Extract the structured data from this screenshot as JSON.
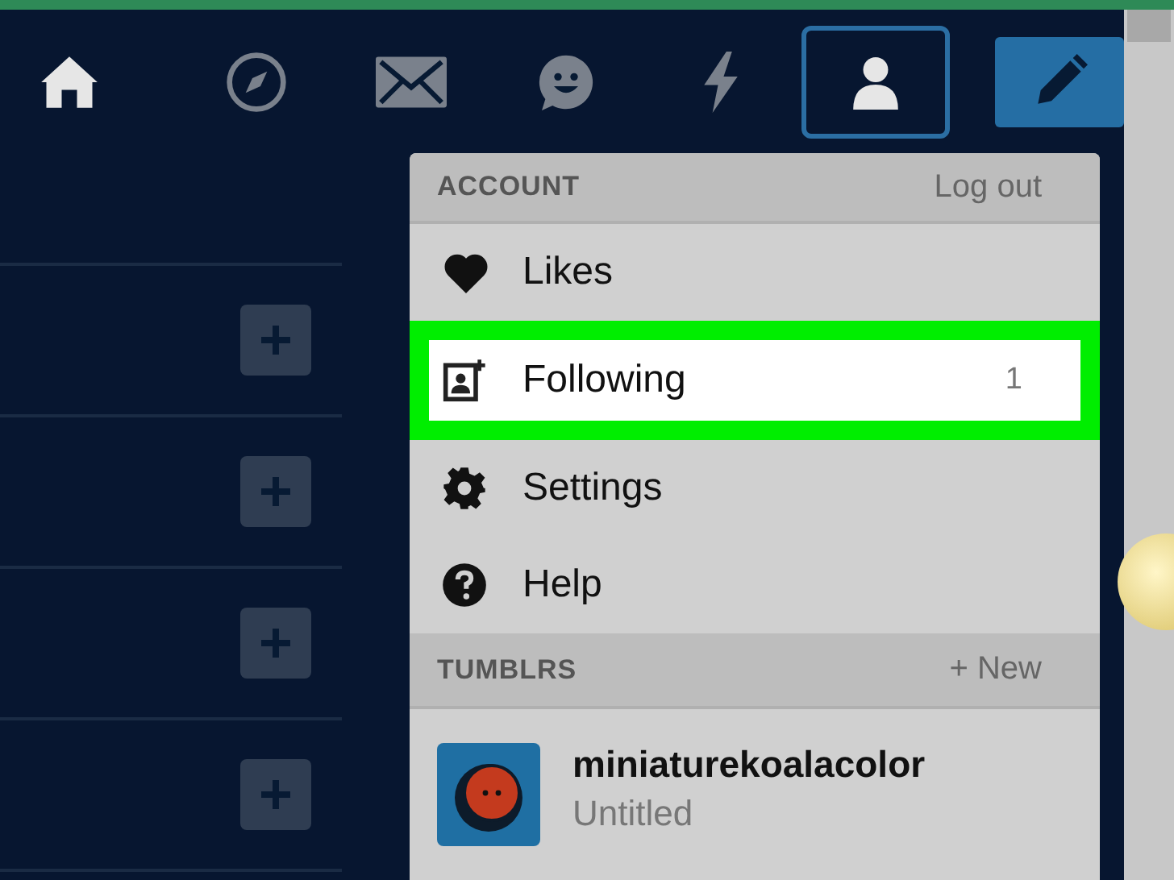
{
  "nav": [
    {
      "kind": "home",
      "selected": false
    },
    {
      "kind": "compass",
      "selected": false
    },
    {
      "kind": "mail",
      "selected": false
    },
    {
      "kind": "smiley",
      "selected": false
    },
    {
      "kind": "bolt",
      "selected": false
    },
    {
      "kind": "account",
      "selected": true
    },
    {
      "kind": "compose",
      "selected": false
    }
  ],
  "side_rows": [
    {
      "kind": "empty"
    },
    {
      "kind": "follow"
    },
    {
      "kind": "follow"
    },
    {
      "kind": "follow"
    },
    {
      "kind": "follow"
    }
  ],
  "account_menu": {
    "heading": "ACCOUNT",
    "action": "Log out",
    "items": [
      {
        "kind": "heart",
        "label": "Likes",
        "highlighted": false
      },
      {
        "kind": "following",
        "label": "Following",
        "count": "1",
        "highlighted": true
      },
      {
        "kind": "gear",
        "label": "Settings",
        "highlighted": false
      },
      {
        "kind": "help",
        "label": "Help",
        "highlighted": false
      }
    ],
    "tumblrs_heading": "TUMBLRS",
    "tumblrs_action": "+ New",
    "blogs": [
      {
        "name": "miniaturekoalacolor",
        "subtitle": "Untitled"
      }
    ]
  }
}
